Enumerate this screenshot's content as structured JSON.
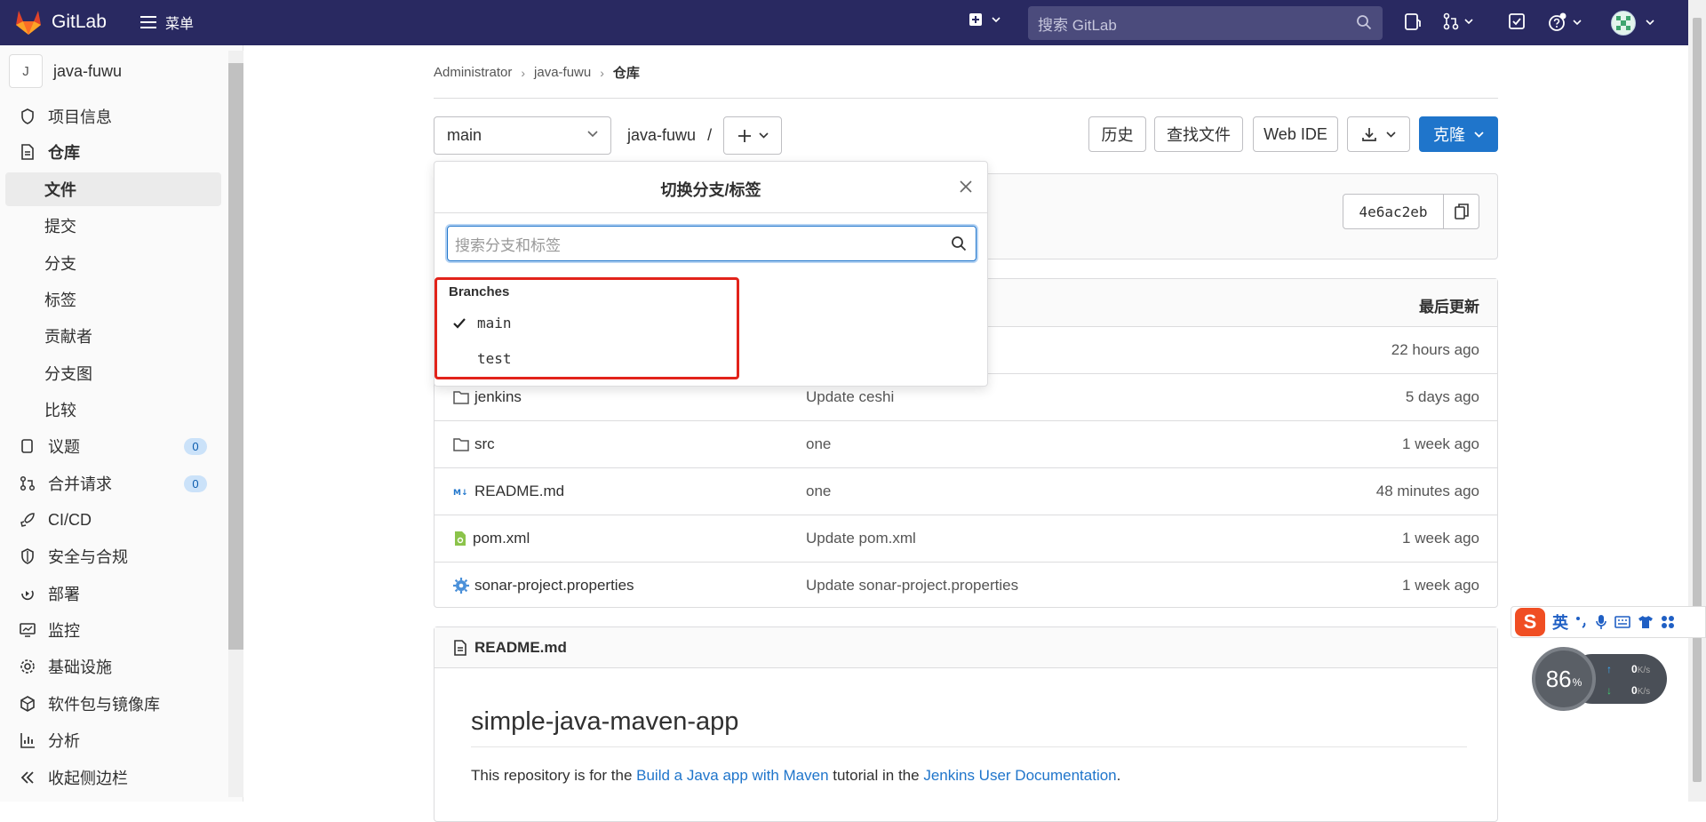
{
  "nav": {
    "brand": "GitLab",
    "menu_label": "菜单",
    "search_placeholder": "搜索 GitLab"
  },
  "sidebar": {
    "project_initial": "J",
    "project_name": "java-fuwu",
    "items": [
      {
        "label": "项目信息",
        "icon": "info-icon"
      },
      {
        "label": "仓库",
        "icon": "document-icon"
      },
      {
        "label": "文件"
      },
      {
        "label": "提交"
      },
      {
        "label": "分支"
      },
      {
        "label": "标签"
      },
      {
        "label": "贡献者"
      },
      {
        "label": "分支图"
      },
      {
        "label": "比较"
      },
      {
        "label": "议题",
        "icon": "issues-icon",
        "badge": "0"
      },
      {
        "label": "合并请求",
        "icon": "merge-request-icon",
        "badge": "0"
      },
      {
        "label": "CI/CD",
        "icon": "rocket-icon"
      },
      {
        "label": "安全与合规",
        "icon": "shield-icon"
      },
      {
        "label": "部署",
        "icon": "deploy-icon"
      },
      {
        "label": "监控",
        "icon": "monitor-icon"
      },
      {
        "label": "基础设施",
        "icon": "cloud-gear-icon"
      },
      {
        "label": "软件包与镜像库",
        "icon": "package-icon"
      },
      {
        "label": "分析",
        "icon": "chart-icon"
      }
    ],
    "collapse_label": "收起侧边栏"
  },
  "breadcrumb": {
    "items": [
      "Administrator",
      "java-fuwu",
      "仓库"
    ]
  },
  "toolbar": {
    "branch": "main",
    "path": "java-fuwu",
    "path_sep": "/",
    "history": "历史",
    "find_file": "查找文件",
    "web_ide": "Web IDE",
    "clone": "克隆"
  },
  "commit": {
    "sha": "4e6ac2eb"
  },
  "files": {
    "last_update_header": "最后更新",
    "rows": [
      {
        "name": "jenkins",
        "type": "folder",
        "message": "Update ceshi",
        "time": "5 days ago"
      },
      {
        "name": "src",
        "type": "folder",
        "message": "one",
        "time": "1 week ago"
      },
      {
        "name": "README.md",
        "type": "markdown",
        "message": "one",
        "time": "48 minutes ago"
      },
      {
        "name": "pom.xml",
        "type": "xml",
        "message": "Update pom.xml",
        "time": "1 week ago"
      },
      {
        "name": "sonar-project.properties",
        "type": "properties",
        "message": "Update sonar-project.properties",
        "time": "1 week ago"
      }
    ],
    "first_row_time": "22 hours ago"
  },
  "readme": {
    "filename": "README.md",
    "title": "simple-java-maven-app",
    "text_1": "This repository is for the ",
    "link_1": "Build a Java app with Maven",
    "text_2": " tutorial in the ",
    "link_2": "Jenkins User Documentation",
    "text_3": "."
  },
  "dropdown": {
    "title": "切换分支/标签",
    "search_placeholder": "搜索分支和标签",
    "section": "Branches",
    "branches": [
      {
        "name": "main",
        "selected": true
      },
      {
        "name": "test",
        "selected": false
      }
    ]
  },
  "widgets": {
    "ime_lang": "英",
    "net_percent": "86",
    "net_percent_unit": "%",
    "up_speed": "0",
    "down_speed": "0",
    "speed_unit": "K/s"
  },
  "colors": {
    "nav_bg": "#292961",
    "primary": "#1f75cb",
    "highlight_box": "#e2231a"
  }
}
